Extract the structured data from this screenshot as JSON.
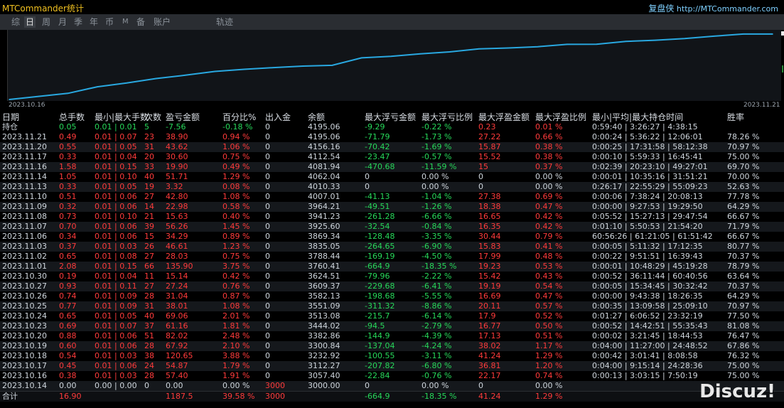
{
  "app_title": "MTCommander统计",
  "brand": {
    "name": "复盘侠",
    "url": "http://MTCommander.com"
  },
  "tabs": [
    "综",
    "日",
    "周",
    "月",
    "季",
    "年",
    "币",
    "M",
    "备",
    "账户",
    "轨迹"
  ],
  "active_tab": 1,
  "chart": {
    "start_label": "2023.10.16",
    "end_label": "2023.11.21",
    "line_color": "#29a8e0"
  },
  "chart_data": {
    "type": "line",
    "x": [
      "2023.10.14",
      "2023.10.16",
      "2023.10.17",
      "2023.10.18",
      "2023.10.19",
      "2023.10.20",
      "2023.10.23",
      "2023.10.24",
      "2023.10.25",
      "2023.10.26",
      "2023.10.27",
      "2023.10.30",
      "2023.11.01",
      "2023.11.02",
      "2023.11.03",
      "2023.11.06",
      "2023.11.07",
      "2023.11.08",
      "2023.11.09",
      "2023.11.10",
      "2023.11.13",
      "2023.11.14",
      "2023.11.15",
      "2023.11.16",
      "2023.11.17",
      "2023.11.20",
      "2023.11.21"
    ],
    "values": [
      3000.0,
      3057.4,
      3112.27,
      3232.92,
      3300.84,
      3382.86,
      3444.02,
      3513.08,
      3551.09,
      3582.13,
      3609.37,
      3624.51,
      3760.41,
      3788.44,
      3835.05,
      3869.34,
      3925.6,
      3941.23,
      3964.21,
      4007.01,
      4010.33,
      4062.04,
      4081.94,
      4112.54,
      4156.16,
      4195.06,
      4195.06
    ],
    "ylim": [
      3000,
      4220
    ]
  },
  "headers": [
    "日期",
    "总手数",
    "最小|最大手数",
    "次数",
    "盈亏金额",
    "百分比%",
    "出入金",
    "余额",
    "最大浮亏金额",
    "最大浮亏比例",
    "最大浮盈金额",
    "最大浮盈比例",
    "最小|平均|最大持仓时间",
    "胜率"
  ],
  "holding_row": [
    "持仓",
    "0.05",
    "0.01 | 0.01",
    "5",
    "-7.56",
    "-0.18 %",
    "0",
    "4195.06",
    "-9.29",
    "-0.22 %",
    "0.23",
    "0.01 %",
    "0:59:40 | 3:26:27 | 4:38:15",
    ""
  ],
  "rows": [
    [
      "2023.11.21",
      "0.49",
      "0.01 | 0.07",
      "23",
      "38.90",
      "0.94 %",
      "0",
      "4195.06",
      "-71.79",
      "-1.73 %",
      "27.22",
      "0.66 %",
      "0:00:24 | 5:36:22 | 12:06:01",
      "78.26 %"
    ],
    [
      "2023.11.20",
      "0.55",
      "0.01 | 0.05",
      "31",
      "43.62",
      "1.06 %",
      "0",
      "4156.16",
      "-70.42",
      "-1.69 %",
      "15.87",
      "0.38 %",
      "0:00:25 | 17:31:58 | 58:12:38",
      "70.97 %"
    ],
    [
      "2023.11.17",
      "0.33",
      "0.01 | 0.04",
      "20",
      "30.60",
      "0.75 %",
      "0",
      "4112.54",
      "-23.47",
      "-0.57 %",
      "15.52",
      "0.38 %",
      "0:00:10 | 5:59:33 | 16:45:41",
      "75.00 %"
    ],
    [
      "2023.11.16",
      "1.58",
      "0.01 | 0.15",
      "33",
      "19.90",
      "0.49 %",
      "0",
      "4081.94",
      "-470.68",
      "-11.59 %",
      "15",
      "0.37 %",
      "0:02:39 | 20:23:10 | 49:27:01",
      "69.70 %"
    ],
    [
      "2023.11.14",
      "1.05",
      "0.01 | 0.10",
      "40",
      "51.71",
      "1.29 %",
      "0",
      "4062.04",
      "0",
      "0.00 %",
      "0",
      "0.00 %",
      "0:00:01 | 10:35:16 | 31:51:21",
      "70.00 %"
    ],
    [
      "2023.11.13",
      "0.33",
      "0.01 | 0.05",
      "19",
      "3.32",
      "0.08 %",
      "0",
      "4010.33",
      "0",
      "0.00 %",
      "0",
      "0.00 %",
      "0:26:17 | 22:55:29 | 55:09:23",
      "52.63 %"
    ],
    [
      "2023.11.10",
      "0.51",
      "0.01 | 0.06",
      "27",
      "42.80",
      "1.08 %",
      "0",
      "4007.01",
      "-41.13",
      "-1.04 %",
      "27.38",
      "0.69 %",
      "0:00:06 | 7:38:24 | 20:08:13",
      "77.78 %"
    ],
    [
      "2023.11.09",
      "0.32",
      "0.01 | 0.06",
      "14",
      "22.98",
      "0.58 %",
      "0",
      "3964.21",
      "-49.51",
      "-1.26 %",
      "18.38",
      "0.47 %",
      "0:00:00 | 9:27:53 | 19:29:50",
      "64.29 %"
    ],
    [
      "2023.11.08",
      "0.73",
      "0.01 | 0.10",
      "21",
      "15.63",
      "0.40 %",
      "0",
      "3941.23",
      "-261.28",
      "-6.66 %",
      "16.65",
      "0.42 %",
      "0:05:52 | 15:27:13 | 29:47:54",
      "66.67 %"
    ],
    [
      "2023.11.07",
      "0.70",
      "0.01 | 0.06",
      "39",
      "56.26",
      "1.45 %",
      "0",
      "3925.60",
      "-32.54",
      "-0.84 %",
      "16.35",
      "0.42 %",
      "0:01:10 | 5:50:53 | 21:54:20",
      "71.79 %"
    ],
    [
      "2023.11.06",
      "0.34",
      "0.01 | 0.06",
      "15",
      "34.29",
      "0.89 %",
      "0",
      "3869.34",
      "-128.48",
      "-3.35 %",
      "30.44",
      "0.79 %",
      "60:56:26 | 61:21:05 | 61:51:42",
      "66.67 %"
    ],
    [
      "2023.11.03",
      "0.37",
      "0.01 | 0.03",
      "26",
      "46.61",
      "1.23 %",
      "0",
      "3835.05",
      "-264.65",
      "-6.90 %",
      "15.83",
      "0.41 %",
      "0:00:05 | 5:11:32 | 17:12:35",
      "80.77 %"
    ],
    [
      "2023.11.02",
      "0.65",
      "0.01 | 0.08",
      "27",
      "28.03",
      "0.75 %",
      "0",
      "3788.44",
      "-169.19",
      "-4.50 %",
      "17.99",
      "0.48 %",
      "0:00:22 | 9:51:51 | 16:39:43",
      "70.37 %"
    ],
    [
      "2023.11.01",
      "2.08",
      "0.01 | 0.15",
      "66",
      "135.90",
      "3.75 %",
      "0",
      "3760.41",
      "-664.9",
      "-18.35 %",
      "19.23",
      "0.53 %",
      "0:00:01 | 10:48:29 | 45:19:28",
      "78.79 %"
    ],
    [
      "2023.10.30",
      "0.19",
      "0.01 | 0.04",
      "11",
      "15.14",
      "0.42 %",
      "0",
      "3624.51",
      "-79.96",
      "-2.22 %",
      "15.42",
      "0.43 %",
      "0:00:52 | 36:11:44 | 60:40:56",
      "63.64 %"
    ],
    [
      "2023.10.27",
      "0.93",
      "0.01 | 0.11",
      "27",
      "27.24",
      "0.76 %",
      "0",
      "3609.37",
      "-229.68",
      "-6.41 %",
      "19.19",
      "0.54 %",
      "0:00:05 | 15:34:45 | 30:32:42",
      "70.37 %"
    ],
    [
      "2023.10.26",
      "0.74",
      "0.01 | 0.09",
      "28",
      "31.04",
      "0.87 %",
      "0",
      "3582.13",
      "-198.68",
      "-5.55 %",
      "16.69",
      "0.47 %",
      "0:00:00 | 9:43:38 | 18:26:35",
      "64.29 %"
    ],
    [
      "2023.10.25",
      "0.77",
      "0.01 | 0.09",
      "31",
      "38.01",
      "1.08 %",
      "0",
      "3551.09",
      "-311.32",
      "-8.86 %",
      "20.11",
      "0.57 %",
      "0:00:35 | 13:09:58 | 25:09:10",
      "70.97 %"
    ],
    [
      "2023.10.24",
      "0.65",
      "0.01 | 0.05",
      "40",
      "69.06",
      "2.01 %",
      "0",
      "3513.08",
      "-215.7",
      "-6.14 %",
      "17.9",
      "0.52 %",
      "0:01:27 | 6:06:52 | 23:32:19",
      "77.50 %"
    ],
    [
      "2023.10.23",
      "0.69",
      "0.01 | 0.07",
      "37",
      "61.16",
      "1.81 %",
      "0",
      "3444.02",
      "-94.5",
      "-2.79 %",
      "16.77",
      "0.50 %",
      "0:00:52 | 14:42:51 | 55:35:43",
      "81.08 %"
    ],
    [
      "2023.10.20",
      "0.88",
      "0.01 | 0.06",
      "51",
      "82.02",
      "2.48 %",
      "0",
      "3382.86",
      "-144.9",
      "-4.39 %",
      "17.13",
      "0.51 %",
      "0:00:02 | 3:21:45 | 18:44:53",
      "76.47 %"
    ],
    [
      "2023.10.19",
      "0.60",
      "0.01 | 0.06",
      "28",
      "67.92",
      "2.10 %",
      "0",
      "3300.84",
      "-137.04",
      "-4.24 %",
      "38.02",
      "1.17 %",
      "0:04:00 | 11:27:00 | 24:48:52",
      "67.86 %"
    ],
    [
      "2023.10.18",
      "0.54",
      "0.01 | 0.03",
      "38",
      "120.65",
      "3.88 %",
      "0",
      "3232.92",
      "-100.55",
      "-3.11 %",
      "41.24",
      "1.29 %",
      "0:00:42 | 3:01:41 | 8:08:58",
      "76.32 %"
    ],
    [
      "2023.10.17",
      "0.45",
      "0.01 | 0.06",
      "24",
      "54.87",
      "1.79 %",
      "0",
      "3112.27",
      "-207.82",
      "-6.80 %",
      "36.81",
      "1.20 %",
      "0:04:00 | 9:15:14 | 24:28:36",
      "75.00 %"
    ],
    [
      "2023.10.16",
      "0.38",
      "0.01 | 0.03",
      "28",
      "57.40",
      "1.91 %",
      "0",
      "3057.40",
      "-22.84",
      "-0.76 %",
      "22.17",
      "0.74 %",
      "0:00:13 | 3:03:15 | 7:50:19",
      "75.00 %"
    ],
    [
      "2023.10.14",
      "0.00",
      "0.00 | 0.00",
      "0",
      "0.00",
      "0.00 %",
      "3000",
      "3000.00",
      "0",
      "0.00 %",
      "0",
      "0.00 %",
      "",
      ""
    ]
  ],
  "total_row": [
    "合计",
    "16.90",
    "",
    "",
    "1187.5",
    "39.58 %",
    "3000",
    "",
    "-664.9",
    "-18.35 %",
    "41.24",
    "1.29 %",
    "",
    ""
  ],
  "watermark": "Discuz!"
}
